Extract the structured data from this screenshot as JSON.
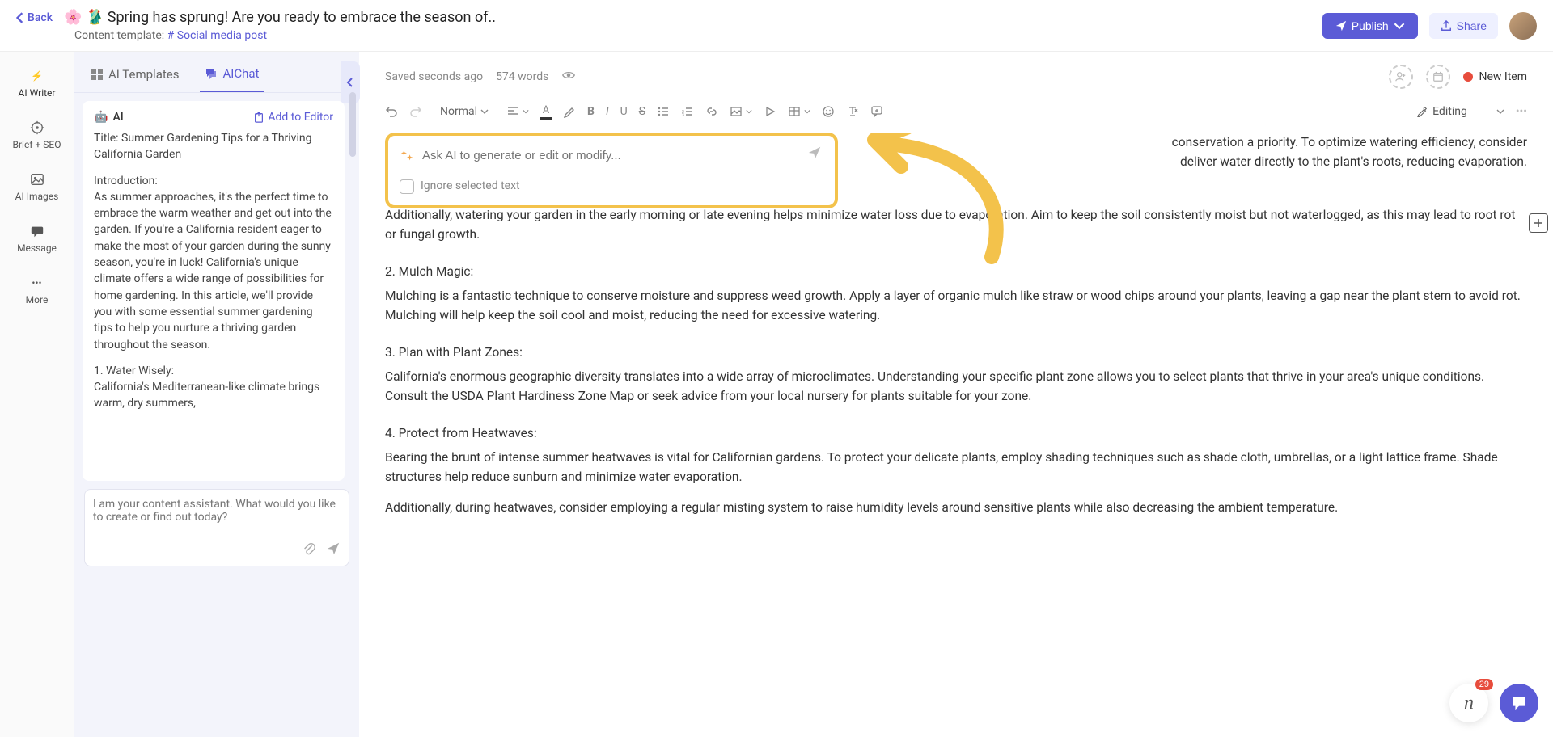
{
  "header": {
    "back": "Back",
    "title": "🌸 🥻 Spring has sprung! Are you ready to embrace the season of..",
    "template_label": "Content template:",
    "template_link": "# Social media post",
    "publish": "Publish",
    "share": "Share"
  },
  "rail": {
    "ai_writer": "AI Writer",
    "brief_seo": "Brief + SEO",
    "ai_images": "AI Images",
    "message": "Message",
    "more": "More"
  },
  "side": {
    "tab_templates": "AI Templates",
    "tab_chat": "AIChat",
    "ai_label": "AI",
    "add_to_editor": "Add to Editor",
    "chat_placeholder": "I am your content assistant. What would you like to create or find out today?",
    "ai_text": {
      "title_line": "Title: Summer Gardening Tips for a Thriving California Garden",
      "intro_label": "Introduction:",
      "intro_body": "As summer approaches, it's the perfect time to embrace the warm weather and get out into the garden. If you're a California resident eager to make the most of your garden during the sunny season, you're in luck! California's unique climate offers a wide range of possibilities for home gardening. In this article, we'll provide you with some essential summer gardening tips to help you nurture a thriving garden throughout the season.",
      "sec1_head": "1. Water Wisely:",
      "sec1_body": "California's Mediterranean-like climate brings warm, dry summers,"
    }
  },
  "meta": {
    "saved": "Saved seconds ago",
    "words": "574 words",
    "new_item": "New Item"
  },
  "toolbar": {
    "style": "Normal",
    "editing": "Editing"
  },
  "prompt": {
    "placeholder": "Ask AI to generate or edit or modify...",
    "ignore": "Ignore selected text"
  },
  "content": {
    "sec1_head_trunc": "1  Water Wisely:",
    "p1_right": "conservation a priority. To optimize watering efficiency, consider",
    "p1_right2": "deliver water directly to the plant's roots, reducing evaporation.",
    "p2": "Additionally, watering your garden in the early morning or late evening helps minimize water loss due to evaporation. Aim to keep the soil consistently moist but not waterlogged, as this may lead to root rot or fungal growth.",
    "sec2_head": "2. Mulch Magic:",
    "sec2_body": "Mulching is a fantastic technique to conserve moisture and suppress weed growth. Apply a layer of organic mulch like straw or wood chips around your plants, leaving a gap near the plant stem to avoid rot. Mulching will help keep the soil cool and moist, reducing the need for excessive watering.",
    "sec3_head": "3. Plan with Plant Zones:",
    "sec3_body": "California's enormous geographic diversity translates into a wide array of microclimates. Understanding your specific plant zone allows you to select plants that thrive in your area's unique conditions. Consult the USDA Plant Hardiness Zone Map or seek advice from your local nursery for plants suitable for your zone.",
    "sec4_head": "4. Protect from Heatwaves:",
    "sec4_body": "Bearing the brunt of intense summer heatwaves is vital for Californian gardens. To protect your delicate plants, employ shading techniques such as shade cloth, umbrellas, or a light lattice frame. Shade structures help reduce sunburn and minimize water evaporation.",
    "sec4_body2": "Additionally, during heatwaves, consider employing a regular misting system to raise humidity levels around sensitive plants while also decreasing the ambient temperature."
  },
  "badge": {
    "count": "29"
  }
}
